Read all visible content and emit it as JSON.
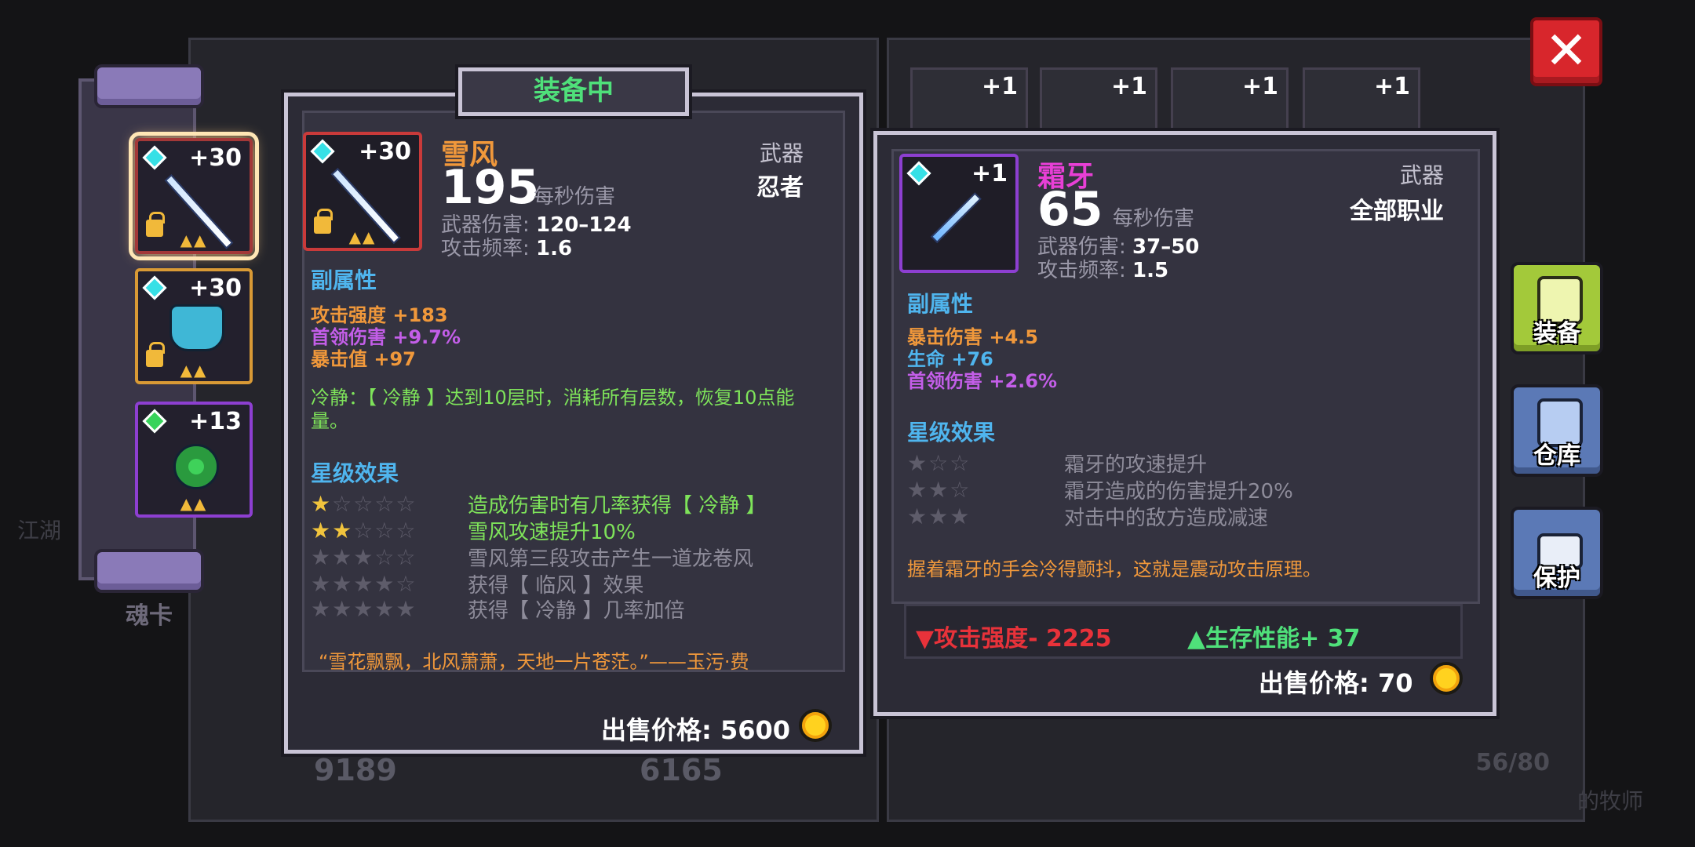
{
  "background": {
    "stat_left": "9189",
    "stat_right": "6165",
    "bag_count": "56/80",
    "side_left": "江湖",
    "side_right": "的牧师",
    "top_slots": [
      "+1",
      "+1",
      "+1",
      "+1"
    ]
  },
  "slots": {
    "soul_card_label": "魂卡",
    "items": [
      {
        "level": "+30",
        "name": "snowwind-weapon"
      },
      {
        "level": "+30",
        "name": "fox-pet"
      },
      {
        "level": "+13",
        "name": "green-eye-orb"
      }
    ]
  },
  "equipped_tab": "装备中",
  "equipped": {
    "name": "雪风",
    "level": "+30",
    "dps": "195",
    "dps_label": "每秒伤害",
    "damage_label": "武器伤害:",
    "damage": "120–124",
    "rate_label": "攻击频率:",
    "rate": "1.6",
    "type": "武器",
    "class": "忍者",
    "sub_title": "副属性",
    "attributes": [
      {
        "label": "攻击强度 +183",
        "color": "#f0983b"
      },
      {
        "label": "首领伤害 +9.7%",
        "color": "#c35ee8"
      },
      {
        "label": "暴击值 +97",
        "color": "#f0983b"
      }
    ],
    "passive": "冷静：【 冷静 】达到10层时，消耗所有层数，恢复10点能量。",
    "star_title": "星级效果",
    "star_effects": [
      {
        "stars": 1,
        "text": "造成伤害时有几率获得【 冷静 】",
        "active": true
      },
      {
        "stars": 2,
        "text": "雪风攻速提升10%",
        "active": true
      },
      {
        "stars": 3,
        "text": "雪风第三段攻击产生一道龙卷风",
        "active": false
      },
      {
        "stars": 4,
        "text": "获得【 临风 】效果",
        "active": false
      },
      {
        "stars": 5,
        "text": "获得【 冷静 】几率加倍",
        "active": false
      }
    ],
    "quote": "“雪花飘飘，北风萧萧，天地一片苍茫。”——玉污·费",
    "price_label": "出售价格:",
    "price": "5600"
  },
  "compare": {
    "name": "霜牙",
    "level": "+1",
    "dps": "65",
    "dps_label": "每秒伤害",
    "damage_label": "武器伤害:",
    "damage": "37–50",
    "rate_label": "攻击频率:",
    "rate": "1.5",
    "type": "武器",
    "class": "全部职业",
    "sub_title": "副属性",
    "attributes": [
      {
        "label": "暴击伤害 +4.5",
        "color": "#f0983b"
      },
      {
        "label": "生命 +76",
        "color": "#4fb5ee"
      },
      {
        "label": "首领伤害 +2.6%",
        "color": "#c35ee8"
      }
    ],
    "star_title": "星级效果",
    "star_effects": [
      {
        "stars": 1,
        "text": "霜牙的攻速提升"
      },
      {
        "stars": 2,
        "text": "霜牙造成的伤害提升20%"
      },
      {
        "stars": 3,
        "text": "对击中的敌方造成减速"
      }
    ],
    "flavor": "握着霜牙的手会冷得颤抖，这就是震动攻击原理。",
    "delta_attack": "攻击强度- 2225",
    "delta_survival": "生存性能+ 37",
    "price_label": "出售价格:",
    "price": "70"
  },
  "buttons": {
    "close": "✕",
    "equip": "装备",
    "storage": "仓库",
    "protect": "保护"
  },
  "colors": {
    "equipped_name": "#f0983b",
    "compare_name": "#e83fd6",
    "green": "#4fe07a",
    "red": "#e8323a",
    "section": "#4fb5ee"
  }
}
